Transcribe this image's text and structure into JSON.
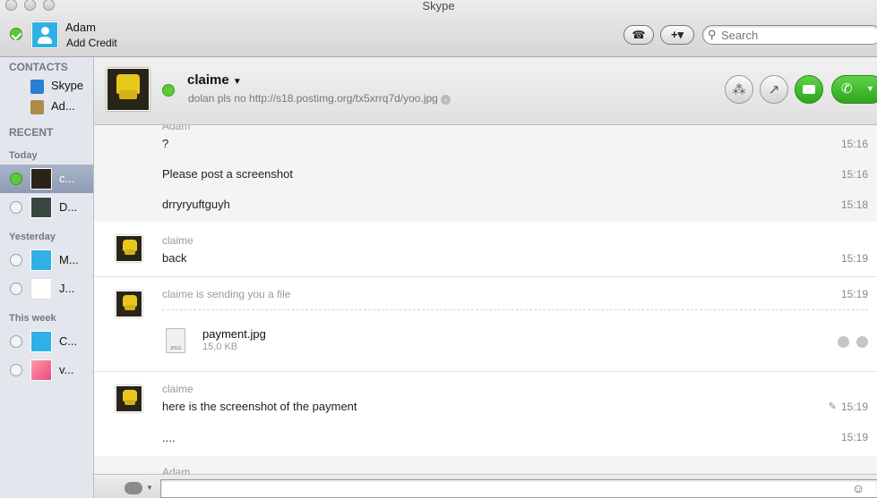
{
  "window": {
    "title": "Skype"
  },
  "account": {
    "name": "Adam",
    "credit_label": "Add Credit"
  },
  "toolbar": {
    "dialpad_icon": "dialpad-icon",
    "add_label": "+▾",
    "search_placeholder": "Search"
  },
  "sidebar": {
    "contacts_heading": "CONTACTS",
    "contacts": [
      {
        "label": "Skype"
      },
      {
        "label": "Ad..."
      }
    ],
    "recent_heading": "RECENT",
    "groups": [
      {
        "label": "Today"
      },
      {
        "label": "Yesterday"
      },
      {
        "label": "This week"
      }
    ],
    "recent": [
      {
        "label": "c..."
      },
      {
        "label": "D..."
      },
      {
        "label": "M..."
      },
      {
        "label": "J..."
      },
      {
        "label": "C..."
      },
      {
        "label": "v..."
      }
    ]
  },
  "conversation": {
    "name": "claime",
    "mood": "dolan pls no  http://s18.postimg.org/tx5xrrq7d/yoo.jpg"
  },
  "messages": {
    "m0": {
      "sender": "Adam"
    },
    "m1": {
      "text": "?",
      "time": "15:16"
    },
    "m2": {
      "text": "Please post a screenshot",
      "time": "15:16"
    },
    "m3": {
      "text": "drryryuftguyh",
      "time": "15:18"
    },
    "m4": {
      "sender": "claime",
      "text": "back",
      "time": "15:19"
    },
    "m5": {
      "sender": "claime is sending you a file",
      "time": "15:19",
      "file_name": "payment.jpg",
      "file_size": "15,0 KB"
    },
    "m6": {
      "sender": "claime",
      "text": "here is the screenshot of the payment",
      "time": "15:19"
    },
    "m7": {
      "text": "....",
      "time": "15:19"
    },
    "m8": {
      "sender": "Adam"
    }
  },
  "colors": {
    "online": "#5ec83b",
    "selected": "#8d9bb3",
    "call": "#2ea51b"
  }
}
